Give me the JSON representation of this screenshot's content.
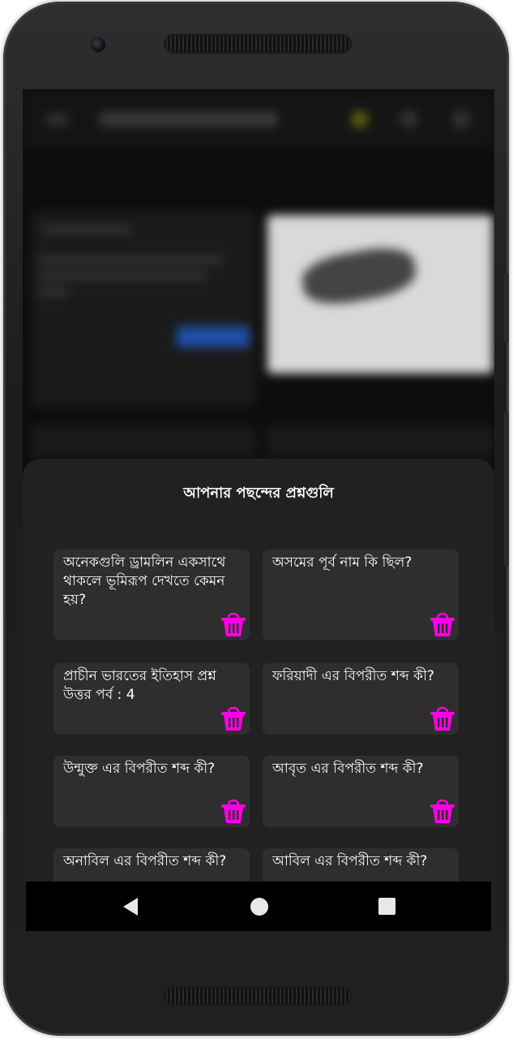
{
  "sheet": {
    "title": "আপনার পছন্দের প্রশ্নগুলি",
    "accent_color": "#ff00e6",
    "cards": [
      {
        "question": "অনেকগুলি ড্রামলিন একসাথে থাকলে ভূমিরূপ দেখতে কেমন হয়?",
        "action_icon": "trash-icon"
      },
      {
        "question": "অসমের পূর্ব নাম কি ছিল?",
        "action_icon": "trash-icon"
      },
      {
        "question": "প্রাচীন ভারতের ইতিহাস প্রশ্ন উত্তর পর্ব : 4",
        "action_icon": "trash-icon"
      },
      {
        "question": "ফরিয়াদী এর বিপরীত শব্দ কী?",
        "action_icon": "trash-icon"
      },
      {
        "question": "উন্মুক্ত এর বিপরীত শব্দ কী?",
        "action_icon": "trash-icon"
      },
      {
        "question": "আবৃত এর বিপরীত শব্দ কী?",
        "action_icon": "trash-icon"
      },
      {
        "question": "অনাবিল এর বিপরীত শব্দ কী?",
        "action_icon": "trash-icon"
      },
      {
        "question": "আবিল এর বিপরীত শব্দ কী?",
        "action_icon": "trash-icon"
      }
    ]
  },
  "navigation_bar": {
    "buttons": [
      "back-icon",
      "home-icon",
      "recents-icon"
    ]
  }
}
